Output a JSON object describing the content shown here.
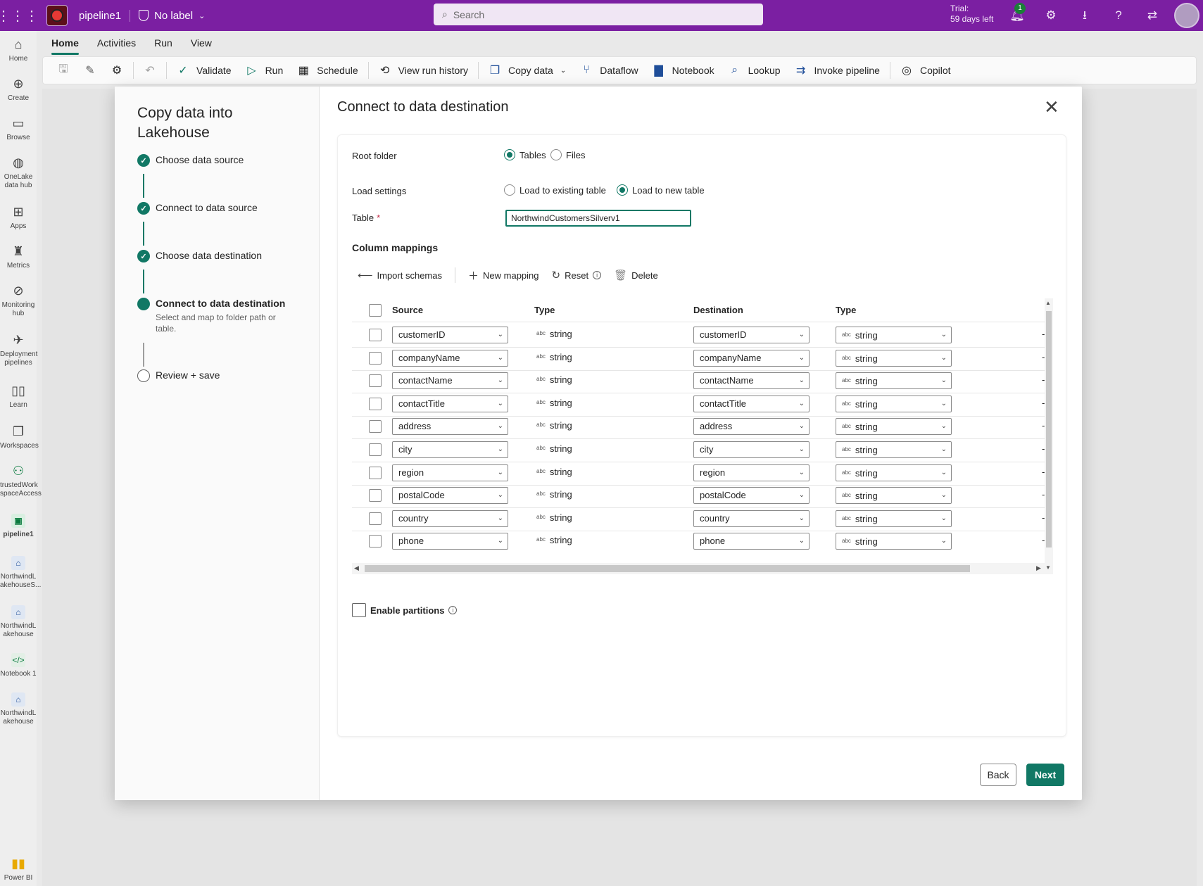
{
  "header": {
    "pipeline_name": "pipeline1",
    "label": "No label",
    "search_placeholder": "Search",
    "trial_line1": "Trial:",
    "trial_line2": "59 days left",
    "notif_count": "1"
  },
  "rail": [
    {
      "label": "Home",
      "icon": "home-icon"
    },
    {
      "label": "Create",
      "icon": "plus-circle-icon"
    },
    {
      "label": "Browse",
      "icon": "folder-icon"
    },
    {
      "label": "OneLake data hub",
      "icon": "onelake-icon"
    },
    {
      "label": "Apps",
      "icon": "apps-icon"
    },
    {
      "label": "Metrics",
      "icon": "trophy-icon"
    },
    {
      "label": "Monitoring hub",
      "icon": "monitor-icon"
    },
    {
      "label": "Deployment pipelines",
      "icon": "rocket-icon"
    },
    {
      "label": "Learn",
      "icon": "book-icon"
    },
    {
      "label": "Workspaces",
      "icon": "workspaces-icon"
    },
    {
      "label": "trustedWork spaceAccess",
      "icon": "people-icon"
    },
    {
      "label": "pipeline1",
      "icon": "pipeline-icon"
    },
    {
      "label": "NorthwindL akehouseS...",
      "icon": "lakehouse-icon"
    },
    {
      "label": "NorthwindL akehouse",
      "icon": "lakehouse-icon"
    },
    {
      "label": "Notebook 1",
      "icon": "notebook-icon"
    },
    {
      "label": "NorthwindL akehouse",
      "icon": "lakehouse-icon"
    },
    {
      "label": "Power BI",
      "icon": "powerbi-icon"
    }
  ],
  "ribbon_tabs": [
    "Home",
    "Activities",
    "Run",
    "View"
  ],
  "toolbar": {
    "validate": "Validate",
    "run": "Run",
    "schedule": "Schedule",
    "view_run_history": "View run history",
    "copy_data": "Copy data",
    "dataflow": "Dataflow",
    "notebook": "Notebook",
    "lookup": "Lookup",
    "invoke_pipeline": "Invoke pipeline",
    "copilot": "Copilot"
  },
  "wizard": {
    "title": "Copy data into Lakehouse",
    "steps": [
      {
        "label": "Choose data source",
        "state": "done"
      },
      {
        "label": "Connect to data source",
        "state": "done"
      },
      {
        "label": "Choose data destination",
        "state": "done"
      },
      {
        "label": "Connect to data destination",
        "state": "current",
        "sub": "Select and map to folder path or table."
      },
      {
        "label": "Review + save",
        "state": "todo"
      }
    ]
  },
  "dest": {
    "title": "Connect to data destination",
    "root_folder_label": "Root folder",
    "root_tables": "Tables",
    "root_files": "Files",
    "load_settings_label": "Load settings",
    "load_existing": "Load to existing table",
    "load_new": "Load to new table",
    "table_label": "Table",
    "table_value": "NorthwindCustomersSilverv1",
    "column_mappings": "Column mappings",
    "import_schemas": "Import schemas",
    "new_mapping": "New mapping",
    "reset": "Reset",
    "delete": "Delete",
    "col_source": "Source",
    "col_type": "Type",
    "col_destination": "Destination",
    "col_type2": "Type",
    "enable_partitions": "Enable partitions",
    "back": "Back",
    "next": "Next"
  },
  "mappings": [
    {
      "source": "customerID",
      "type": "string",
      "dest": "customerID",
      "dest_type": "string"
    },
    {
      "source": "companyName",
      "type": "string",
      "dest": "companyName",
      "dest_type": "string"
    },
    {
      "source": "contactName",
      "type": "string",
      "dest": "contactName",
      "dest_type": "string"
    },
    {
      "source": "contactTitle",
      "type": "string",
      "dest": "contactTitle",
      "dest_type": "string"
    },
    {
      "source": "address",
      "type": "string",
      "dest": "address",
      "dest_type": "string"
    },
    {
      "source": "city",
      "type": "string",
      "dest": "city",
      "dest_type": "string"
    },
    {
      "source": "region",
      "type": "string",
      "dest": "region",
      "dest_type": "string"
    },
    {
      "source": "postalCode",
      "type": "string",
      "dest": "postalCode",
      "dest_type": "string"
    },
    {
      "source": "country",
      "type": "string",
      "dest": "country",
      "dest_type": "string"
    },
    {
      "source": "phone",
      "type": "string",
      "dest": "phone",
      "dest_type": "string"
    }
  ],
  "type_abbr": "abc",
  "colors": {
    "accent": "#117865",
    "topbar": "#7b1fa2"
  }
}
